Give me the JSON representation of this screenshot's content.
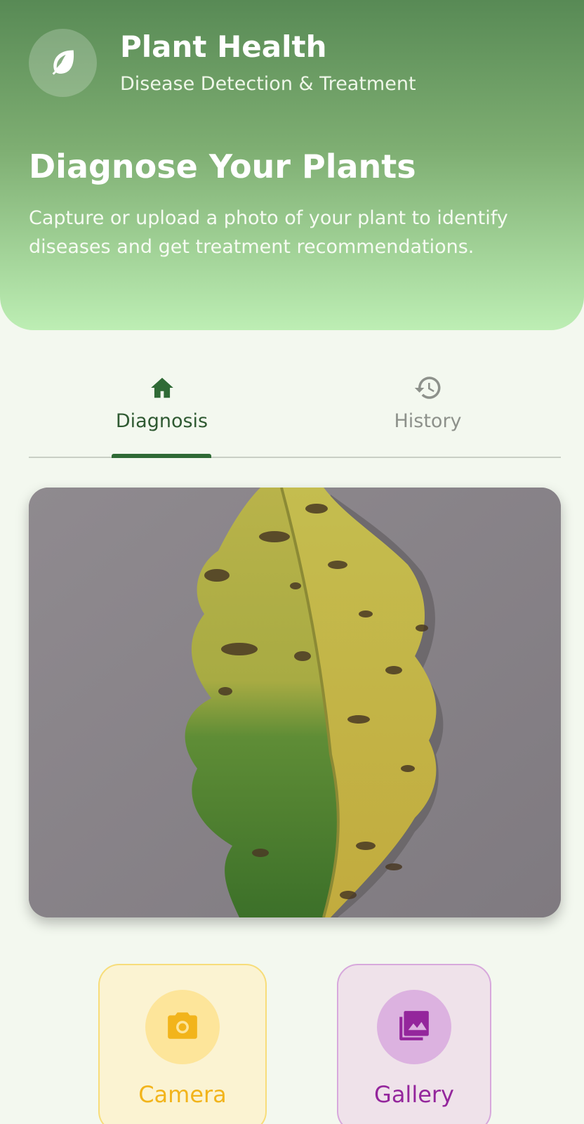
{
  "header": {
    "logo_icon": "leaf-icon",
    "app_title": "Plant Health",
    "app_subtitle": "Disease Detection & Treatment",
    "hero_title": "Diagnose Your Plants",
    "hero_description": "Capture or upload a photo of your plant to identify diseases and get treatment recommendations."
  },
  "tabs": [
    {
      "label": "Diagnosis",
      "icon": "home-icon",
      "selected": true
    },
    {
      "label": "History",
      "icon": "history-icon",
      "selected": false
    }
  ],
  "preview": {
    "image": "diseased-leaf-photo"
  },
  "actions": {
    "camera": {
      "label": "Camera",
      "icon": "camera-icon"
    },
    "gallery": {
      "label": "Gallery",
      "icon": "gallery-icon"
    }
  },
  "colors": {
    "primary": "#2f6a35",
    "header_top": "#588a55",
    "header_bottom": "#bdeeb4",
    "background": "#f3f8ef",
    "camera_accent": "#f2b41b",
    "gallery_accent": "#94269c"
  }
}
